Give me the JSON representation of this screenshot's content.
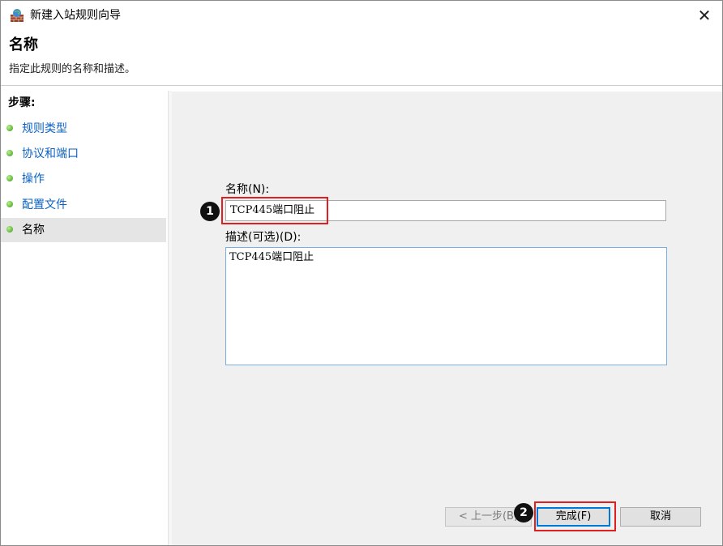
{
  "window": {
    "title": "新建入站规则向导",
    "close_glyph": "✕"
  },
  "header": {
    "title": "名称",
    "description": "指定此规则的名称和描述。"
  },
  "steps": {
    "heading": "步骤:",
    "items": [
      {
        "label": "规则类型",
        "active": false
      },
      {
        "label": "协议和端口",
        "active": false
      },
      {
        "label": "操作",
        "active": false
      },
      {
        "label": "配置文件",
        "active": false
      },
      {
        "label": "名称",
        "active": true
      }
    ]
  },
  "form": {
    "name_label": "名称(N):",
    "name_value": "TCP445端口阻止",
    "desc_label": "描述(可选)(D):",
    "desc_value": "TCP445端口阻止"
  },
  "buttons": {
    "back": "< 上一步(B)",
    "finish": "完成(F)",
    "cancel": "取消"
  },
  "annotations": {
    "badge1": "1",
    "badge2": "2",
    "highlight_color": "#e02020"
  },
  "icons": {
    "app": "firewall-wizard-icon",
    "close": "close-icon",
    "step_bullet": "green-dot-icon"
  }
}
